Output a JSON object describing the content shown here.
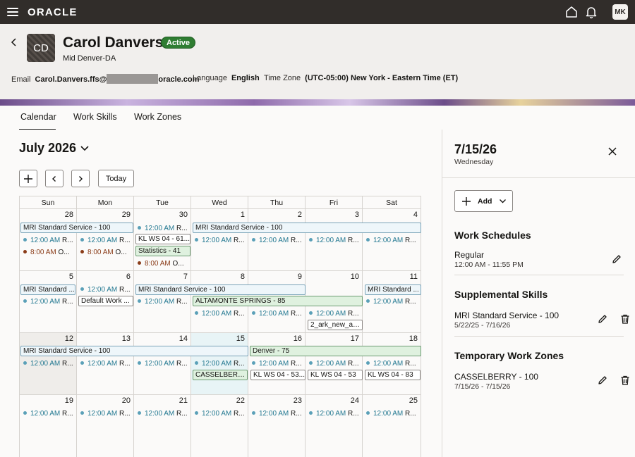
{
  "topbar": {
    "logo": "ORACLE",
    "user_initials": "MK"
  },
  "header": {
    "initials": "CD",
    "name": "Carol Danvers",
    "status": "Active",
    "subtitle": "Mid Denver-DA",
    "email_label": "Email",
    "email_user": "Carol.Danvers.ffs@",
    "email_domain": "oracle.com",
    "language_label": "Language",
    "language_value": "English",
    "timezone_label": "Time Zone",
    "timezone_value": "(UTC-05:00) New York - Eastern Time (ET)"
  },
  "tabs": [
    "Calendar",
    "Work Skills",
    "Work Zones"
  ],
  "calendar": {
    "month": "July 2026",
    "today_button": "Today",
    "weekdays": [
      "Sun",
      "Mon",
      "Tue",
      "Wed",
      "Thu",
      "Fri",
      "Sat"
    ],
    "day_numbers": [
      "28",
      "29",
      "30",
      "1",
      "2",
      "3",
      "4",
      "5",
      "6",
      "7",
      "8",
      "9",
      "10",
      "11",
      "12",
      "13",
      "14",
      "15",
      "16",
      "17",
      "18",
      "19",
      "20",
      "21",
      "22",
      "23",
      "24",
      "25"
    ],
    "events": {
      "mri_100": "MRI Standard Service - 100",
      "mri_short": "MRI Standard ...",
      "r_event": "12:00 AM R...",
      "r_time": "12:00 AM",
      "r_suffix": "R...",
      "o_time": "8:00 AM",
      "o_suffix": "O...",
      "kl61": "KL WS 04 - 61...",
      "stats41": "Statistics - 41",
      "default_work": "Default Work ...",
      "altamonte": "ALTAMONTE SPRINGS - 85",
      "ark": "2_ark_new_ap...",
      "denver": "Denver - 75",
      "casselberry": "CASSELBERR...",
      "kl53a": "KL WS 04 - 53...",
      "kl53b": "KL WS 04 - 53",
      "kl83": "KL WS 04 - 83"
    }
  },
  "side": {
    "date": "7/15/26",
    "weekday": "Wednesday",
    "add_label": "Add",
    "work_schedules": {
      "title": "Work Schedules",
      "item": "Regular",
      "detail": "12:00 AM - 11:55 PM"
    },
    "supplemental_skills": {
      "title": "Supplemental Skills",
      "item": "MRI Standard Service - 100",
      "detail": "5/22/25 - 7/16/26"
    },
    "temporary_zones": {
      "title": "Temporary Work Zones",
      "item": "CASSELBERRY - 100",
      "detail": "7/15/26 - 7/15/26"
    }
  },
  "colors": {
    "topbar": "#312d2a",
    "active_badge": "#2f7d32",
    "event_time": "#227891",
    "event_time_alt": "#8a3c19"
  }
}
